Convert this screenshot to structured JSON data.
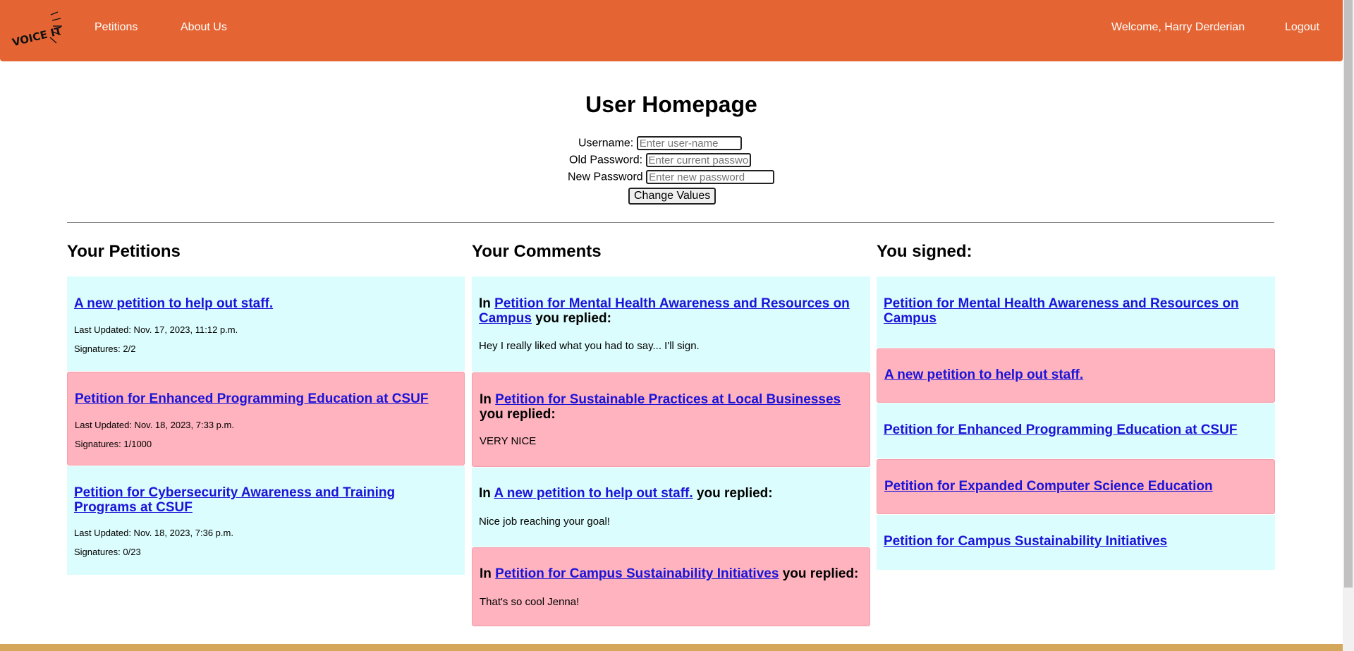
{
  "nav": {
    "logo_text": "VOICE IT!",
    "links": [
      "Petitions",
      "About Us"
    ],
    "welcome": "Welcome, Harry Derderian",
    "logout": "Logout"
  },
  "page": {
    "title": "User Homepage"
  },
  "form": {
    "username_label": "Username:",
    "username_placeholder": "Enter user-name",
    "old_password_label": "Old Password:",
    "old_password_placeholder": "Enter current password",
    "new_password_label": "New Password",
    "new_password_placeholder": "Enter new password",
    "submit_label": "Change Values"
  },
  "petitions": {
    "heading": "Your Petitions",
    "items": [
      {
        "title": "A new petition to help out staff.",
        "updated": "Last Updated: Nov. 17, 2023, 11:12 p.m.",
        "signatures": "Signatures: 2/2"
      },
      {
        "title": "Petition for Enhanced Programming Education at CSUF",
        "updated": "Last Updated: Nov. 18, 2023, 7:33 p.m.",
        "signatures": "Signatures: 1/1000"
      },
      {
        "title": "Petition for Cybersecurity Awareness and Training Programs at CSUF",
        "updated": "Last Updated: Nov. 18, 2023, 7:36 p.m.",
        "signatures": "Signatures: 0/23"
      }
    ]
  },
  "comments": {
    "heading": "Your Comments",
    "prefix": "In",
    "suffix": "you replied:",
    "items": [
      {
        "petition": "Petition for Mental Health Awareness and Resources on Campus",
        "text": "Hey I really liked what you had to say... I'll sign."
      },
      {
        "petition": "Petition for Sustainable Practices at Local Businesses",
        "text": "VERY NICE"
      },
      {
        "petition": "A new petition to help out staff.",
        "text": "Nice job reaching your goal!"
      },
      {
        "petition": "Petition for Campus Sustainability Initiatives",
        "text": "That's so cool Jenna!"
      }
    ]
  },
  "signed": {
    "heading": "You signed:",
    "items": [
      "Petition for Mental Health Awareness and Resources on Campus",
      "A new petition to help out staff.",
      "Petition for Enhanced Programming Education at CSUF",
      "Petition for Expanded Computer Science Education",
      "Petition for Campus Sustainability Initiatives"
    ]
  },
  "colors": {
    "nav": "#e46533",
    "cyan_card": "#dcfdfd",
    "pink_card": "#feb3be",
    "link": "#1b13d8",
    "footer": "#d4a75a"
  }
}
